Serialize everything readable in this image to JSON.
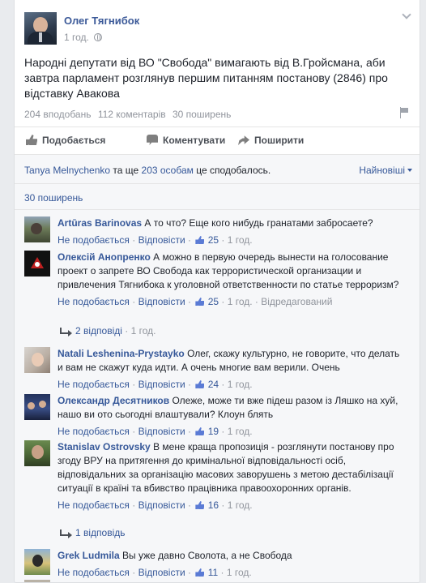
{
  "post": {
    "author": "Олег Тягнибок",
    "time": "1 год.",
    "text": "Народні депутати від ВО \"Свобода\" вимагають від В.Гройсмана, аби завтра парламент розглянув першим питанням постанову (2846) про відставку Авакова",
    "stats": {
      "likes": "204 вподобань",
      "comments": "112 коментарів",
      "shares": "30 поширень"
    }
  },
  "actions": {
    "like": "Подобається",
    "comment": "Коментувати",
    "share": "Поширити"
  },
  "likes_summary": {
    "name": "Tanya Melnychenko",
    "middle": " та ще ",
    "others": "203 особам",
    "tail": " це сподобалось."
  },
  "sort": "Найновіші",
  "shares_link": "30 поширень",
  "icons": [
    "globe-icon",
    "chevron-down-icon",
    "flag-icon",
    "like-icon",
    "comment-icon",
    "share-icon",
    "mini-like-icon",
    "reply-arrow-icon"
  ],
  "colors": {
    "link": "#365899",
    "name": "#3b5998",
    "muted": "#90949c",
    "like_badge": "#5b7bd5"
  },
  "comments": [
    {
      "name": "Artūras Barinovas",
      "text": "А то что? Еще кого нибудь гранатами забросаете?",
      "unlike": "Не подобається",
      "reply": "Відповісти",
      "likes": "25",
      "time": "1 год.",
      "edited": ""
    },
    {
      "name": "Олексій Анопренко",
      "text": "А можно в первую очередь вынести на голосование проект о запрете ВО Свобода как террористической организации и привлечения Тягнибока к уголовной ответственности по статье терроризм?",
      "unlike": "Не подобається",
      "reply": "Відповісти",
      "likes": "25",
      "time": "1 год.",
      "edited": "Відредагований"
    },
    {
      "name": "Natali Leshenina-Prystayko",
      "text": "Олег, скажу культурно, не говорите, что делать и вам не скажут куда идти. А очень многие вам верили. Очень",
      "unlike": "Не подобається",
      "reply": "Відповісти",
      "likes": "24",
      "time": "1 год.",
      "edited": ""
    },
    {
      "name": "Олександр Десятников",
      "text": "Олеже, може ти вже підеш разом із Ляшко на хуй, нашо ви ото сьогодні влаштували? Клоун блять",
      "unlike": "Не подобається",
      "reply": "Відповісти",
      "likes": "19",
      "time": "1 год.",
      "edited": ""
    },
    {
      "name": "Stanislav Ostrovsky",
      "text": "В мене краща пропозиція - розглянути постанову про згоду ВРУ на притягення до кримінальної відповідальності осіб, відповідальних за організацію масових заворушень з метою дестабілізації ситуації в країні та вбивство працівника правоохоронних органів.",
      "unlike": "Не подобається",
      "reply": "Відповісти",
      "likes": "16",
      "time": "1 год.",
      "edited": ""
    },
    {
      "name": "Grek Ludmila",
      "text": "Вы уже давно Сволота, а не Свобода",
      "unlike": "Не подобається",
      "reply": "Відповісти",
      "likes": "11",
      "time": "1 год.",
      "edited": ""
    }
  ],
  "reply_links": [
    {
      "label": "2 відповіді",
      "time": "1 год."
    },
    {
      "label": "1 відповідь",
      "time": ""
    }
  ]
}
